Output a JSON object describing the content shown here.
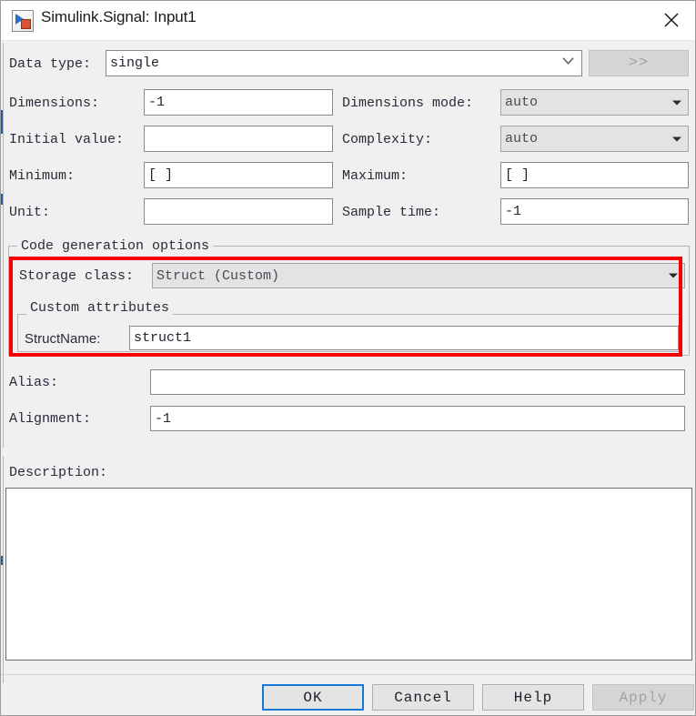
{
  "window": {
    "title": "Simulink.Signal: Input1",
    "icon": "simulink-signal-icon",
    "close_icon": "close-icon"
  },
  "fields": {
    "data_type": {
      "label": "Data type:",
      "value": "single",
      "expand_button": ">>",
      "expand_disabled": true
    },
    "dimensions": {
      "label": "Dimensions:",
      "value": "-1"
    },
    "dimensions_mode": {
      "label": "Dimensions mode:",
      "value": "auto",
      "disabled": true
    },
    "initial_value": {
      "label": "Initial value:",
      "value": ""
    },
    "complexity": {
      "label": "Complexity:",
      "value": "auto",
      "disabled": true
    },
    "minimum": {
      "label": "Minimum:",
      "value": "[ ]"
    },
    "maximum": {
      "label": "Maximum:",
      "value": "[ ]"
    },
    "unit": {
      "label": "Unit:",
      "value": ""
    },
    "sample_time": {
      "label": "Sample time:",
      "value": "-1"
    },
    "alias": {
      "label": "Alias:",
      "value": ""
    },
    "alignment": {
      "label": "Alignment:",
      "value": "-1"
    },
    "description": {
      "label": "Description:",
      "value": ""
    }
  },
  "codegen": {
    "group_title": "Code generation options",
    "storage_class": {
      "label": "Storage class:",
      "value": "Struct (Custom)",
      "disabled": true
    },
    "custom_attributes": {
      "group_title": "Custom attributes",
      "struct_name": {
        "label": "StructName:",
        "value": "struct1"
      }
    },
    "highlight_color": "#f70000"
  },
  "buttons": {
    "ok": {
      "label": "OK",
      "focused": true
    },
    "cancel": {
      "label": "Cancel"
    },
    "help": {
      "label": "Help"
    },
    "apply": {
      "label": "Apply",
      "disabled": true
    }
  }
}
